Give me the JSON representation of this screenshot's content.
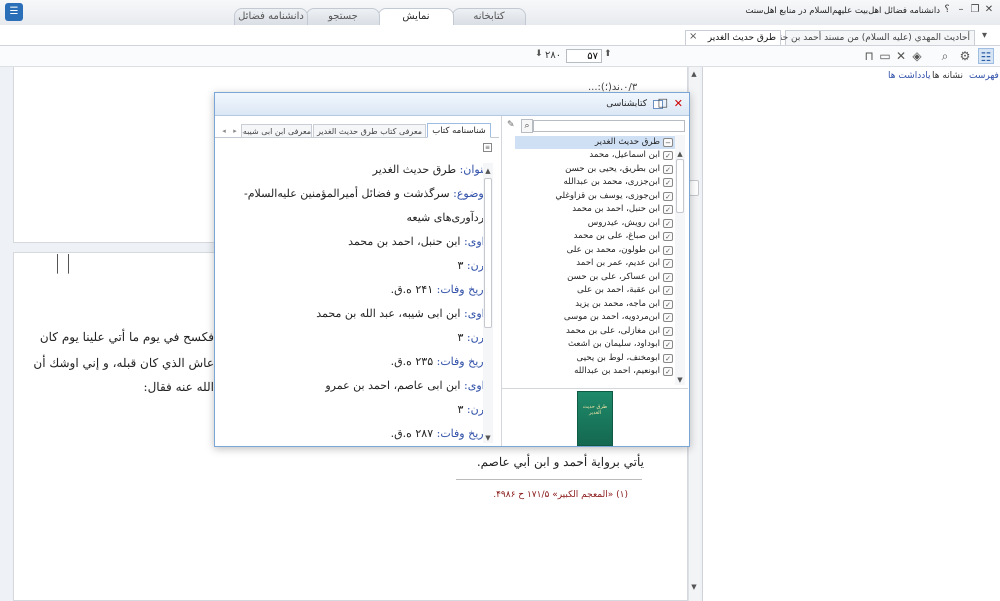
{
  "window": {
    "title": "دانشنامه فضائل اهل‌بیت علیهم‌السلام در منابع اهل‌سنت",
    "help": "؟",
    "minimize": "–",
    "restore": "❐",
    "close": "✕"
  },
  "main_tabs": [
    "کتابخانه",
    "نمایش",
    "جستجو",
    "دانشنامه فضائل"
  ],
  "doc_tabs": {
    "active": "طرق حديث الغدير",
    "active_close": "×",
    "other": "أحاديث المهدي (عليه السلام) من مسند أحمد بن حنبل",
    "dropdown": "▾"
  },
  "toolbar": {
    "page_value": "۵۷",
    "page_total": "۲۸۰"
  },
  "right_panel": {
    "tabs": [
      "فهرست",
      "نشانه ها",
      "یادداشت ها"
    ]
  },
  "top_page": {
    "fragment": "...:(؛)۰/۳.ند"
  },
  "main_text": {
    "line1": "فكسح في يوم ما أتي علينا يوم كان",
    "line2": "عاش الذي كان قبله، و إني اوشك أن",
    "line3": "الله عنه فقال:",
    "line4": "يأتي برواية أحمد و ابن أبي عاصم.",
    "footnote": "(۱)  «المعجم الكبير» ۱۷۱/۵ ح ۴۹۸۶."
  },
  "dialog": {
    "title": "کتابشناسی",
    "close": "✕",
    "maximize": "□",
    "search_placeholder": "",
    "tree_root": "طرق حديث الغدير",
    "tree_items": [
      "ابن اسماعيل، محمد",
      "ابن بطريق، يحيى بن حسن",
      "ابن‌جزری، محمد بن عبدالله",
      "ابن‌جوزی، يوسف بن قزاوغلي",
      "ابن حنبل، احمد بن محمد",
      "ابن رويش، عيدروس",
      "ابن صباغ، على بن محمد",
      "ابن طولون، محمد بن على",
      "ابن عديم، عمر بن احمد",
      "ابن عساكر، على بن حسن",
      "ابن عقبة، احمد بن على",
      "ابن ماجه، محمد بن يزيد",
      "ابن‌مردويه، احمد بن موسى",
      "ابن مغازلى، على بن محمد",
      "ابوداود، سليمان بن اشعث",
      "ابومخنف، لوط بن يحيى",
      "ابونعيم، احمد بن عبدالله"
    ],
    "tabs": [
      "شناسنامه کتاب",
      "معرفی کتاب طرق حدیث الغدیر",
      "معرفی ابن ابی شیبه، ع"
    ],
    "details": {
      "title_label": "عنوان:",
      "title_value": "طرق حديث الغدير",
      "subject_label": "موضوع:",
      "subject_value1": "سرگذشت و فضائل أميرالمؤمنين عليه‌السلام-",
      "subject_value2": "گردآوری‌های شیعه",
      "narrators": [
        {
          "label": "راوی:",
          "value": "ابن حنبل، احمد بن محمد",
          "century_label": "قرن:",
          "century": "۳",
          "death_label": "تاریخ وفات:",
          "death": "۲۴۱ ه.ق."
        },
        {
          "label": "راوی:",
          "value": "ابن ابی شیبه، عبد الله بن محمد",
          "century_label": "قرن:",
          "century": "۳",
          "death_label": "تاریخ وفات:",
          "death": "۲۳۵ ه.ق."
        },
        {
          "label": "راوی:",
          "value": "ابن ابی عاصم، احمد بن عمرو",
          "century_label": "قرن:",
          "century": "۳",
          "death_label": "تاریخ وفات:",
          "death": "۲۸۷ ه.ق."
        }
      ]
    },
    "cover_text": "طرق حديث الغدير"
  },
  "colors": {
    "accent": "#2f4fa8",
    "footnote": "#8b1a1a",
    "cover": "#1f8a6a",
    "selection": "#cfe0f5"
  }
}
